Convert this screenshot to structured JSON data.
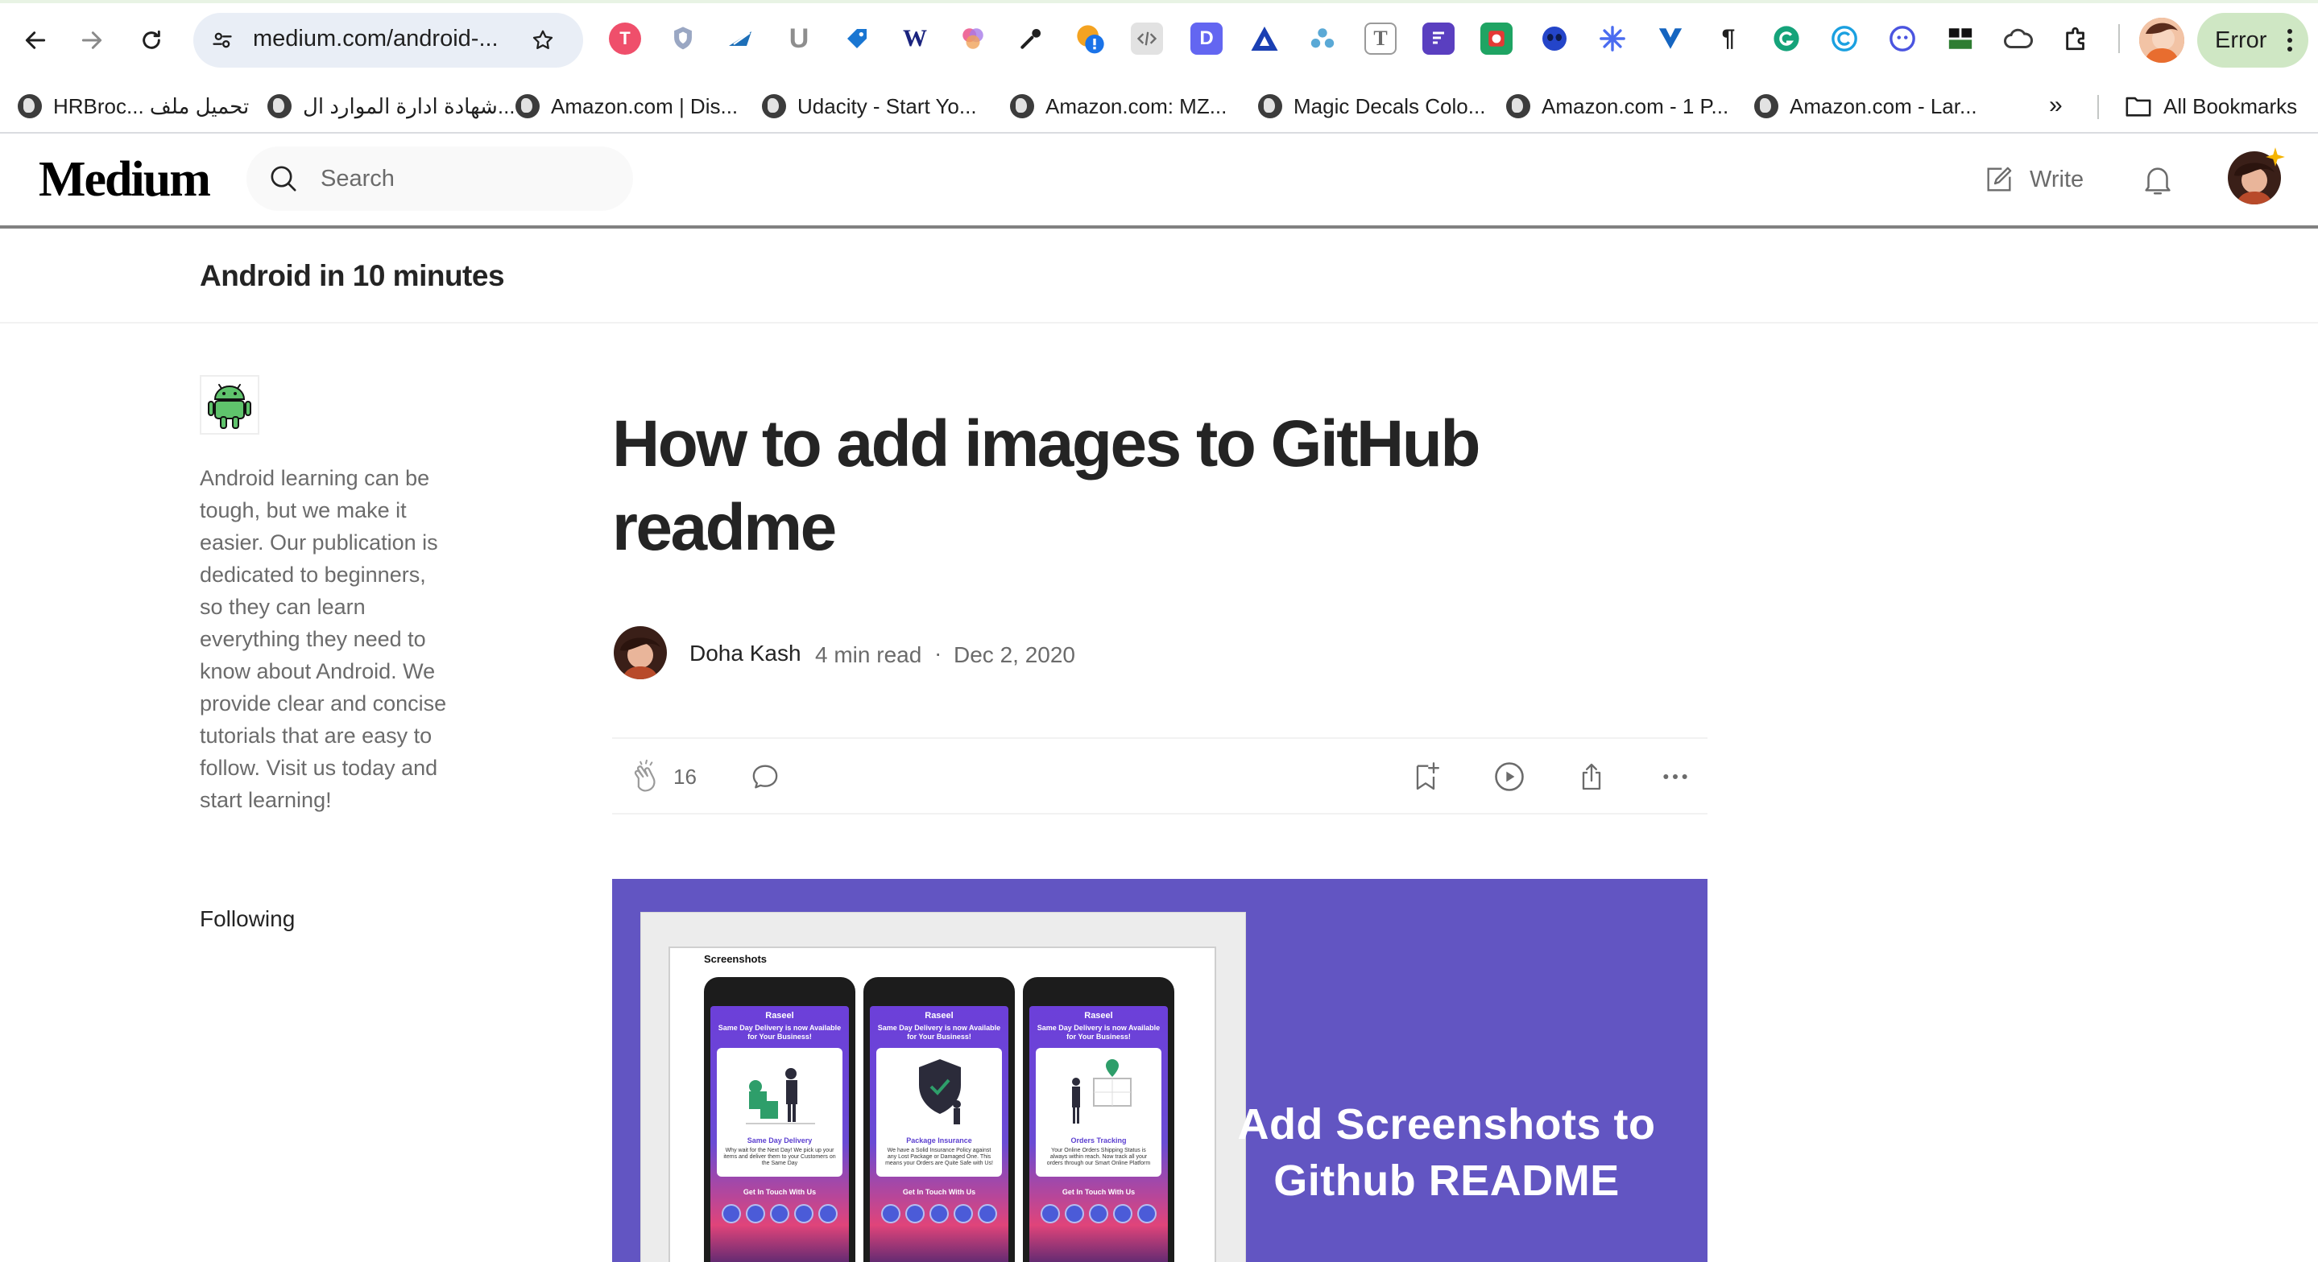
{
  "browser": {
    "url": "medium.com/android-...",
    "error_label": "Error",
    "bookmarks": [
      "HRBroc... تحميل ملف",
      "شهادة ادارة الموارد ال...",
      "Amazon.com | Dis...",
      "Udacity - Start Yo...",
      "Amazon.com: MZ...",
      "Magic Decals Colo...",
      "Amazon.com - 1 P...",
      "Amazon.com - Lar..."
    ],
    "more_bookmarks": "»",
    "all_bookmarks": "All Bookmarks"
  },
  "header": {
    "logo": "Medium",
    "search_placeholder": "Search",
    "write_label": "Write"
  },
  "publication": {
    "name": "Android in 10 minutes",
    "description": "Android learning can be tough, but we make it easier. Our publication is dedicated to beginners, so they can learn everything they need to know about Android. We provide clear and concise tutorials that are easy to follow. Visit us today and start learning!",
    "follow_status": "Following"
  },
  "article": {
    "title": "How to add images to GitHub readme",
    "author": "Doha Kash",
    "read_time": "4 min read",
    "separator": "·",
    "date": "Dec 2, 2020",
    "claps": "16"
  },
  "hero_image": {
    "screenshots_label": "Screenshots",
    "headline": "Add Screenshots to Github README",
    "phones": [
      {
        "brand": "Raseel",
        "heading": "Same Day Delivery is now Available for Your Business!",
        "card_title": "Same Day Delivery",
        "card_text": "Why wait for the Next Day! We pick up your items and deliver them to your Customers on the Same Day",
        "contact": "Get In Touch With Us"
      },
      {
        "brand": "Raseel",
        "heading": "Same Day Delivery is now Available for Your Business!",
        "card_title": "Package Insurance",
        "card_text": "We have a Solid Insurance Policy against any Lost Package or Damaged One. This means your Orders are Quite Safe with Us!",
        "contact": "Get In Touch With Us"
      },
      {
        "brand": "Raseel",
        "heading": "Same Day Delivery is now Available for Your Business!",
        "card_title": "Orders Tracking",
        "card_text": "Your Online Orders Shipping Status is always within reach. Now track all your orders through our Smart Online Platform",
        "contact": "Get In Touch With Us"
      }
    ],
    "background_color": "#6255c2"
  },
  "colors": {
    "text_primary": "#242424",
    "text_secondary": "#6b6b6b",
    "browser_error_pill": "#cfe7c4"
  },
  "icons": {
    "browser_nav": [
      "back-arrow-icon",
      "forward-arrow-icon",
      "reload-icon"
    ],
    "extensions": [
      "todoist-icon",
      "shield-icon",
      "bird-icon",
      "u-icon",
      "tag-icon",
      "w-icon",
      "pinwheel-icon",
      "eyedropper-icon",
      "notify-icon",
      "code-icon",
      "d-icon",
      "triangle-icon",
      "dots-icon",
      "t-icon",
      "form-icon",
      "record-icon",
      "alien-icon",
      "asterisk-icon",
      "v-icon",
      "pilcrow-icon",
      "grammarly-icon",
      "c-icon",
      "face-icon",
      "grid-icon",
      "cloud-icon",
      "puzzle-icon"
    ],
    "article_actions": [
      "clap-icon",
      "comment-icon",
      "bookmark-add-icon",
      "play-icon",
      "share-icon",
      "more-icon"
    ]
  }
}
